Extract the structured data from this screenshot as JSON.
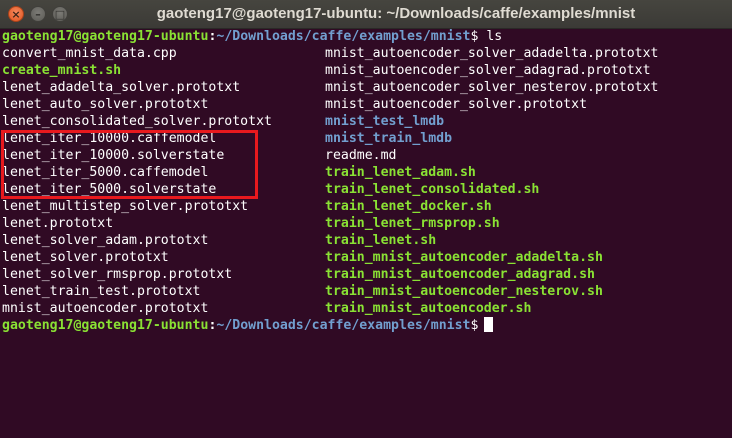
{
  "window": {
    "title": "gaoteng17@gaoteng17-ubuntu: ~/Downloads/caffe/examples/mnist",
    "buttons": {
      "close": "×",
      "minimize": "–",
      "maximize": "□"
    }
  },
  "prompt": {
    "user_host": "gaoteng17@gaoteng17-ubuntu",
    "sep": ":",
    "path": "~/Downloads/caffe/examples/mnist",
    "symbol": "$",
    "command": " ls"
  },
  "ls_rows": [
    {
      "c1": {
        "text": "convert_mnist_data.cpp",
        "kind": "pl"
      },
      "c2": {
        "text": "mnist_autoencoder_solver_adadelta.prototxt",
        "kind": "pl"
      }
    },
    {
      "c1": {
        "text": "create_mnist.sh",
        "kind": "exe"
      },
      "c2": {
        "text": "mnist_autoencoder_solver_adagrad.prototxt",
        "kind": "pl"
      }
    },
    {
      "c1": {
        "text": "lenet_adadelta_solver.prototxt",
        "kind": "pl"
      },
      "c2": {
        "text": "mnist_autoencoder_solver_nesterov.prototxt",
        "kind": "pl"
      }
    },
    {
      "c1": {
        "text": "lenet_auto_solver.prototxt",
        "kind": "pl"
      },
      "c2": {
        "text": "mnist_autoencoder_solver.prototxt",
        "kind": "pl"
      }
    },
    {
      "c1": {
        "text": "lenet_consolidated_solver.prototxt",
        "kind": "pl"
      },
      "c2": {
        "text": "mnist_test_lmdb",
        "kind": "dir"
      }
    },
    {
      "c1": {
        "text": "lenet_iter_10000.caffemodel",
        "kind": "pl"
      },
      "c2": {
        "text": "mnist_train_lmdb",
        "kind": "dir"
      }
    },
    {
      "c1": {
        "text": "lenet_iter_10000.solverstate",
        "kind": "pl"
      },
      "c2": {
        "text": "readme.md",
        "kind": "pl"
      }
    },
    {
      "c1": {
        "text": "lenet_iter_5000.caffemodel",
        "kind": "pl"
      },
      "c2": {
        "text": "train_lenet_adam.sh",
        "kind": "exe"
      }
    },
    {
      "c1": {
        "text": "lenet_iter_5000.solverstate",
        "kind": "pl"
      },
      "c2": {
        "text": "train_lenet_consolidated.sh",
        "kind": "exe"
      }
    },
    {
      "c1": {
        "text": "lenet_multistep_solver.prototxt",
        "kind": "pl"
      },
      "c2": {
        "text": "train_lenet_docker.sh",
        "kind": "exe"
      }
    },
    {
      "c1": {
        "text": "lenet.prototxt",
        "kind": "pl"
      },
      "c2": {
        "text": "train_lenet_rmsprop.sh",
        "kind": "exe"
      }
    },
    {
      "c1": {
        "text": "lenet_solver_adam.prototxt",
        "kind": "pl"
      },
      "c2": {
        "text": "train_lenet.sh",
        "kind": "exe"
      }
    },
    {
      "c1": {
        "text": "lenet_solver.prototxt",
        "kind": "pl"
      },
      "c2": {
        "text": "train_mnist_autoencoder_adadelta.sh",
        "kind": "exe"
      }
    },
    {
      "c1": {
        "text": "lenet_solver_rmsprop.prototxt",
        "kind": "pl"
      },
      "c2": {
        "text": "train_mnist_autoencoder_adagrad.sh",
        "kind": "exe"
      }
    },
    {
      "c1": {
        "text": "lenet_train_test.prototxt",
        "kind": "pl"
      },
      "c2": {
        "text": "train_mnist_autoencoder_nesterov.sh",
        "kind": "exe"
      }
    },
    {
      "c1": {
        "text": "mnist_autoencoder.prototxt",
        "kind": "pl"
      },
      "c2": {
        "text": "train_mnist_autoencoder.sh",
        "kind": "exe"
      }
    }
  ],
  "colors": {
    "background": "#300a24",
    "executable": "#8ae234",
    "directory": "#729fcf",
    "highlight_box": "#e8191e"
  }
}
